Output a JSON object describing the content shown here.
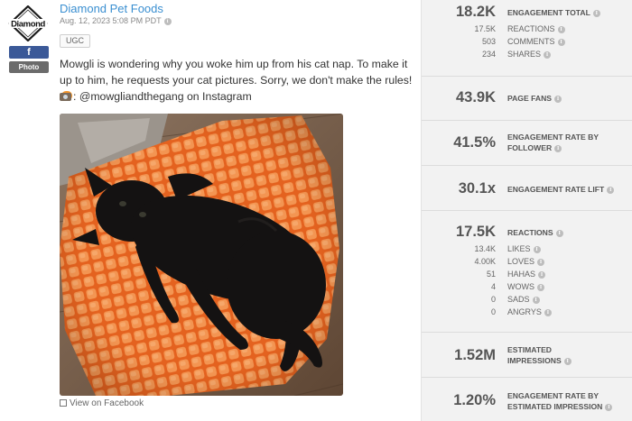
{
  "post": {
    "page_name": "Diamond Pet Foods",
    "date": "Aug. 12, 2023 5:08 PM PDT",
    "network_badge": "f",
    "type_badge": "Photo",
    "logo_text": "Diamond",
    "tag": "UGC",
    "caption": "Mowgli is wondering why you woke him up from his cat nap. To make it up to him, he requests your cat pictures. Sorry, we don't make the rules!",
    "credit": ": @mowgliandthegang on Instagram",
    "view_link": "View on Facebook"
  },
  "metrics": {
    "engagement_total": {
      "value": "18.2K",
      "label": "ENGAGEMENT TOTAL",
      "breakdown": [
        {
          "value": "17.5K",
          "label": "REACTIONS"
        },
        {
          "value": "503",
          "label": "COMMENTS"
        },
        {
          "value": "234",
          "label": "SHARES"
        }
      ]
    },
    "page_fans": {
      "value": "43.9K",
      "label": "PAGE FANS"
    },
    "engagement_rate_follower": {
      "value": "41.5%",
      "label_line1": "ENGAGEMENT RATE BY",
      "label_line2": "FOLLOWER"
    },
    "engagement_rate_lift": {
      "value": "30.1x",
      "label": "ENGAGEMENT RATE LIFT"
    },
    "reactions": {
      "value": "17.5K",
      "label": "REACTIONS",
      "breakdown": [
        {
          "value": "13.4K",
          "label": "LIKES"
        },
        {
          "value": "4.00K",
          "label": "LOVES"
        },
        {
          "value": "51",
          "label": "HAHAS"
        },
        {
          "value": "4",
          "label": "WOWS"
        },
        {
          "value": "0",
          "label": "SADS"
        },
        {
          "value": "0",
          "label": "ANGRYS"
        }
      ]
    },
    "estimated_impressions": {
      "value": "1.52M",
      "label_line1": "ESTIMATED",
      "label_line2": "IMPRESSIONS"
    },
    "engagement_rate_impression": {
      "value": "1.20%",
      "label_line1": "ENGAGEMENT RATE BY",
      "label_line2": "ESTIMATED IMPRESSION"
    }
  },
  "colors": {
    "facebook": "#3b5998",
    "link": "#3a8fd1",
    "panel_bg": "#f2f2f2",
    "blanket": "#ee7a2f"
  }
}
